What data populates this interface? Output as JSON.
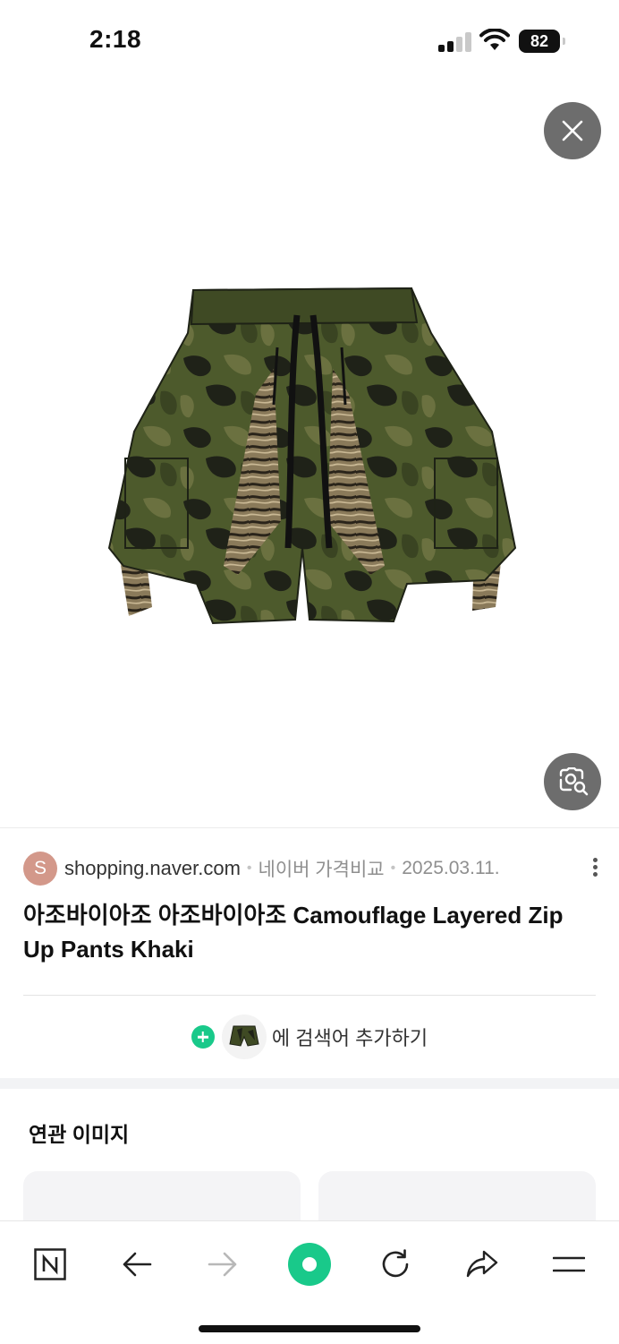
{
  "status_bar": {
    "time": "2:18",
    "battery": "82"
  },
  "source": {
    "initial": "S",
    "domain": "shopping.naver.com",
    "service": "네이버 가격비교",
    "date": "2025.03.11."
  },
  "product": {
    "title": "아조바이아조 아조바이아조 Camouflage Layered Zip Up Pants Khaki",
    "image_alt": "Camouflage layered zip up shorts"
  },
  "add_search": {
    "label": "에 검색어 추가하기"
  },
  "related": {
    "title": "연관 이미지"
  },
  "colors": {
    "accent_green": "#19c98a",
    "overlay_button": "#6d6d6d",
    "avatar": "#d3988a"
  },
  "icons": {
    "close": "close-icon",
    "lens": "image-search-icon",
    "more": "more-vertical-icon",
    "bottom_nav": [
      "naver-home-icon",
      "back-arrow-icon",
      "forward-arrow-icon",
      "green-dot-icon",
      "reload-icon",
      "share-icon",
      "menu-icon"
    ]
  }
}
